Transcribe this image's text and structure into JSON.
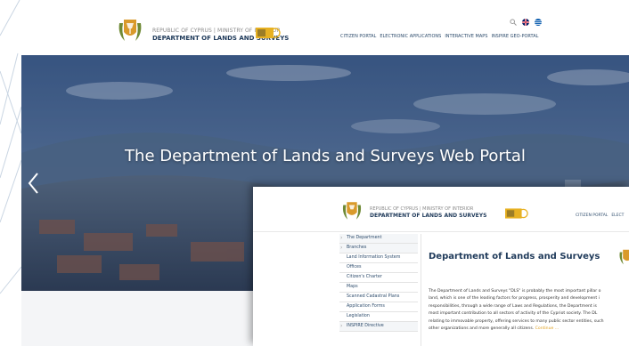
{
  "header": {
    "org_line1": "REPUBLIC OF CYPRUS | MINISTRY OF INTERIOR",
    "org_line2": "DEPARTMENT OF LANDS AND SURVEYS",
    "nav": [
      "CITIZEN PORTAL",
      "ELECTRONIC APPLICATIONS",
      "INTERACTIVE MAPS",
      "INSPIRE GEO-PORTAL"
    ]
  },
  "hero": {
    "title": "The Department of Lands and Surveys Web Portal"
  },
  "overlay": {
    "org_line1": "REPUBLIC OF CYPRUS | MINISTRY OF INTERIOR",
    "org_line2": "DEPARTMENT OF LANDS AND SURVEYS",
    "nav": [
      "CITIZEN PORTAL",
      "ELECT"
    ],
    "sidebar": [
      {
        "label": "The Department",
        "arrow": true
      },
      {
        "label": "Branches",
        "arrow": true
      },
      {
        "label": "Land Information System",
        "arrow": false
      },
      {
        "label": "Offices",
        "arrow": false
      },
      {
        "label": "Citizen's Charter",
        "arrow": false
      },
      {
        "label": "Maps",
        "arrow": false
      },
      {
        "label": "Scanned Cadastral Plans",
        "arrow": false
      },
      {
        "label": "Application Forms",
        "arrow": false
      },
      {
        "label": "Legislation",
        "arrow": false
      },
      {
        "label": "INSPIRE Directive",
        "arrow": true
      }
    ],
    "main_title": "Department of Lands and Surveys",
    "paragraph_lines": [
      "The Department of Lands and Surveys \"DLS\" is probably the  most important pillar o",
      "land, which is one of the leading factors for progress, prosperity and development i",
      "responsibilities, through a wide range of Laws and Regulations, the Department is",
      "most important contribution to all sectors of activity of the Cypriot society. The DL",
      "relating to immovable property, offering services to many public sector entities, such",
      "other organizations and more generally all citizens."
    ],
    "continue_label": "Continue ..."
  },
  "colors": {
    "navy": "#1f3a5a",
    "accent": "#e0a020",
    "flag_uk": "#c8102e",
    "flag_gr": "#0d5eaf"
  },
  "icons": [
    "cyprus-emblem-icon",
    "lands-surveys-badge-icon",
    "search-icon",
    "uk-flag-icon",
    "greek-flag-icon",
    "chevron-left-icon"
  ]
}
